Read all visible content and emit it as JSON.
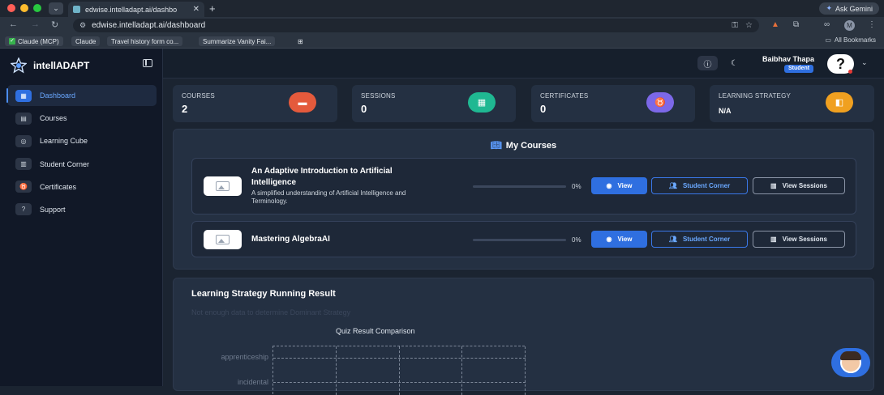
{
  "browser": {
    "tab_title": "edwise.intelladapt.ai/dashbo",
    "tab_close": "✕",
    "new_tab": "+",
    "url": "edwise.intelladapt.ai/dashboard",
    "gemini_label": "Ask Gemini",
    "profile_initial": "M",
    "bookmarks": [
      "Claude (MCP)",
      "Claude",
      "Travel history form co...",
      "Summarize Vanity Fai..."
    ],
    "all_bookmarks": "All Bookmarks"
  },
  "app": {
    "brand": "intellADAPT",
    "nav": [
      {
        "label": "Dashboard",
        "icon": "dashboard-icon",
        "active": true
      },
      {
        "label": "Courses",
        "icon": "courses-icon"
      },
      {
        "label": "Learning Cube",
        "icon": "cube-icon"
      },
      {
        "label": "Student Corner",
        "icon": "chart-icon"
      },
      {
        "label": "Certificates",
        "icon": "certificate-icon"
      },
      {
        "label": "Support",
        "icon": "support-icon"
      }
    ],
    "user": {
      "name": "Baibhav Thapa",
      "role": "Student",
      "avatar_glyph": "?"
    }
  },
  "stats": [
    {
      "label": "COURSES",
      "value": "2",
      "color": "#e45a3c",
      "icon": "course-stat-icon"
    },
    {
      "label": "SESSIONS",
      "value": "0",
      "color": "#1fb892",
      "icon": "session-stat-icon"
    },
    {
      "label": "CERTIFICATES",
      "value": "0",
      "color": "#7c68e8",
      "icon": "certificate-stat-icon"
    },
    {
      "label": "LEARNING STRATEGY",
      "value": "N/A",
      "color": "#f0a020",
      "icon": "strategy-stat-icon"
    }
  ],
  "my_courses": {
    "title": "My Courses",
    "view_label": "View",
    "student_corner_label": "Student Corner",
    "view_sessions_label": "View Sessions",
    "courses": [
      {
        "title_line1": "An Adaptive Introduction to Artificial",
        "title_line2": "Intelligence",
        "desc_line1": "A simplified understanding of Artificial Intelligence and",
        "desc_line2": "Terminology.",
        "progress": "0%"
      },
      {
        "title_line1": "Mastering AlgebraAI",
        "title_line2": "",
        "desc_line1": "",
        "desc_line2": "",
        "progress": "0%"
      }
    ]
  },
  "learning_strategy": {
    "title": "Learning Strategy Running Result",
    "subtitle": "Not enough data to determine Dominant Strategy",
    "chart_title": "Quiz Result Comparison",
    "y_labels": [
      "apprenticeship",
      "incidental"
    ]
  }
}
